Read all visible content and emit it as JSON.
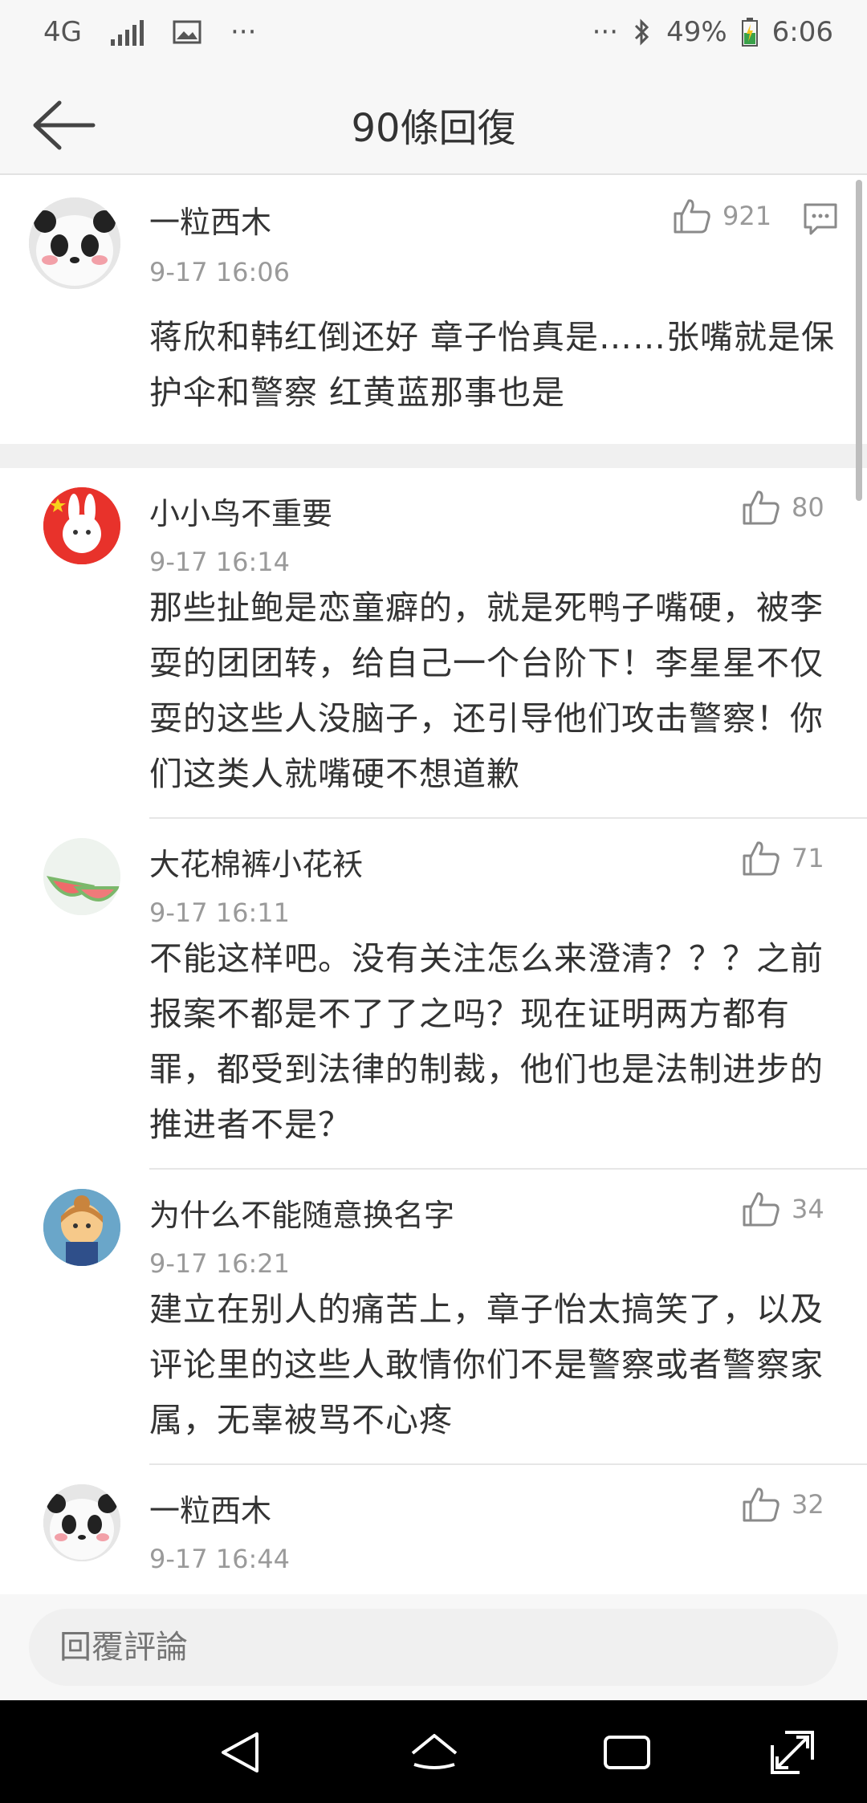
{
  "status_bar": {
    "network": "4G",
    "more_left": "···",
    "more_right": "···",
    "battery": "49%",
    "time": "6:06"
  },
  "header": {
    "title": "90條回復"
  },
  "comments": [
    {
      "user": "一粒西木",
      "time": "9-17 16:06",
      "likes": "921",
      "text": "蒋欣和韩红倒还好  章子怡真是……张嘴就是保护伞和警察  红黄蓝那事也是",
      "avatar_label": "小臉一紅"
    },
    {
      "user": "小小鸟不重要",
      "time": "9-17 16:14",
      "likes": "80",
      "text": "那些扯鲍是恋童癖的，就是死鸭子嘴硬，被李耍的团团转，给自己一个台阶下！李星星不仅耍的这些人没脑子，还引导他们攻击警察！你们这类人就嘴硬不想道歉"
    },
    {
      "user": "大花棉裤小花袄",
      "time": "9-17 16:11",
      "likes": "71",
      "text": "不能这样吧。没有关注怎么来澄清？？？之前报案不都是不了了之吗？现在证明两方都有罪，都受到法律的制裁，他们也是法制进步的推进者不是？"
    },
    {
      "user": "为什么不能随意换名字",
      "time": "9-17 16:21",
      "likes": "34",
      "text": "建立在别人的痛苦上，章子怡太搞笑了，以及评论里的这些人敢情你们不是警察或者警察家属，无辜被骂不心疼"
    },
    {
      "user": "一粒西木",
      "time": "9-17 16:44",
      "likes": "32",
      "text": "",
      "avatar_label": "小臉一紅"
    }
  ],
  "reply_bar": {
    "placeholder": "回覆評論"
  },
  "icons": {
    "back": "arrow-left-icon",
    "like": "thumbs-up-icon",
    "reply": "comment-icon",
    "nav_back": "triangle-back-icon",
    "nav_home": "home-icon",
    "nav_recent": "recent-apps-icon",
    "nav_expand": "expand-icon"
  }
}
